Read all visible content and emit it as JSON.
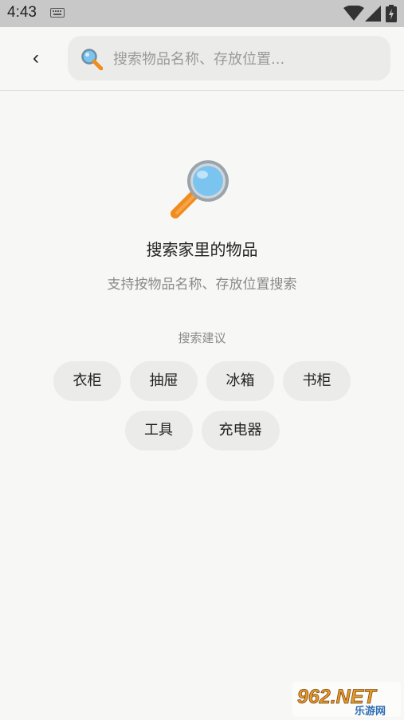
{
  "status_bar": {
    "time": "4:43"
  },
  "header": {
    "back_label": "‹",
    "search_placeholder": "搜索物品名称、存放位置..."
  },
  "empty_state": {
    "title": "搜索家里的物品",
    "subtitle": "支持按物品名称、存放位置搜索"
  },
  "suggestions": {
    "title": "搜索建议",
    "row1": [
      "衣柜",
      "抽屉",
      "冰箱",
      "书柜"
    ],
    "row2": [
      "工具",
      "充电器"
    ]
  },
  "watermark": {
    "main": "962.NET",
    "sub": "乐游网"
  },
  "colors": {
    "background": "#f7f7f5",
    "chip": "#ebebe9",
    "status_bar": "#c8c8c8",
    "magnifier_lens": "#7cc4f0",
    "magnifier_handle": "#f08c1e"
  }
}
